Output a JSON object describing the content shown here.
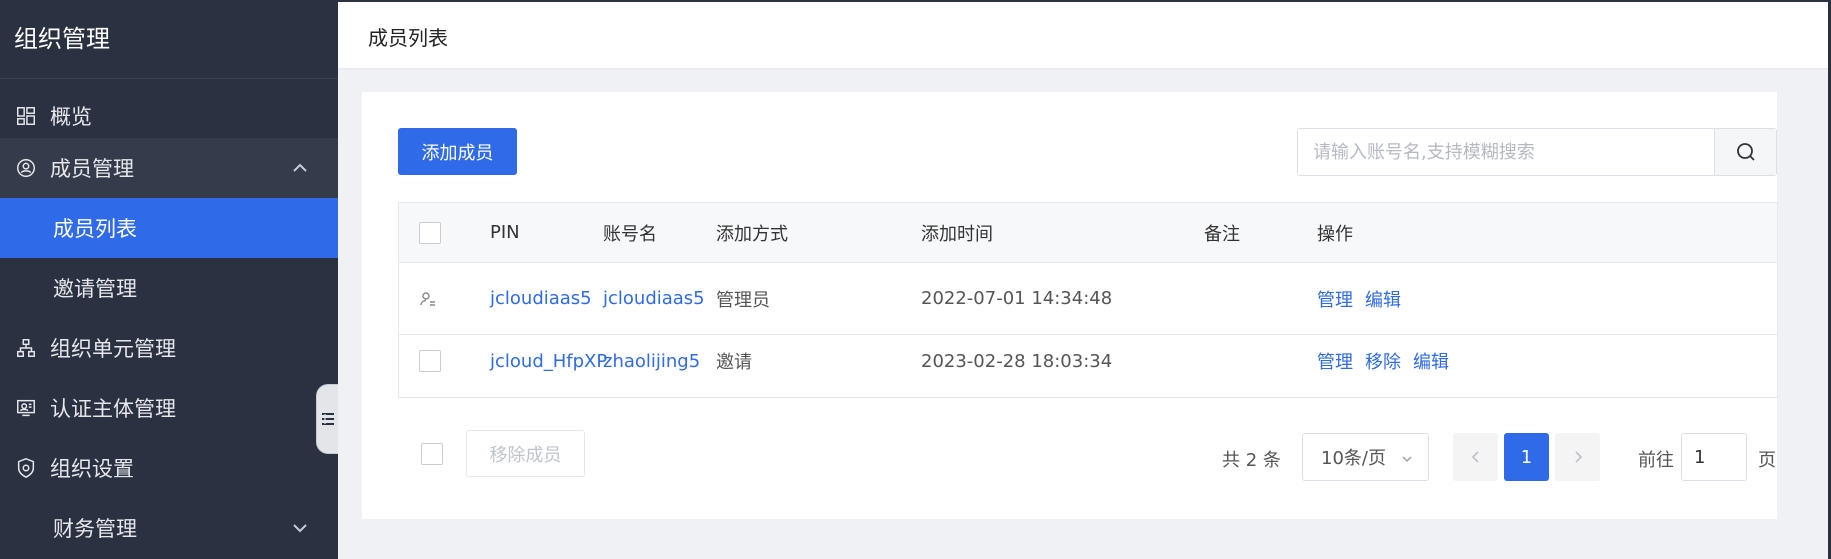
{
  "sidebar": {
    "title": "组织管理",
    "items": [
      {
        "label": "概览",
        "icon": "dashboard-icon"
      },
      {
        "label": "成员管理",
        "icon": "member-icon"
      },
      {
        "label": "成员列表"
      },
      {
        "label": "邀请管理"
      },
      {
        "label": "组织单元管理",
        "icon": "org-unit-icon"
      },
      {
        "label": "认证主体管理",
        "icon": "certification-icon"
      },
      {
        "label": "组织设置",
        "icon": "settings-shield-icon"
      },
      {
        "label": "财务管理"
      }
    ]
  },
  "header": {
    "title": "成员列表"
  },
  "toolbar": {
    "add_label": "添加成员",
    "search_placeholder": "请输入账号名,支持模糊搜索"
  },
  "table": {
    "columns": [
      "PIN",
      "账号名",
      "添加方式",
      "添加时间",
      "备注",
      "操作"
    ],
    "rows": [
      {
        "pin": "jcloudiaas5",
        "account": "jcloudiaas5",
        "method": "管理员",
        "time": "2022-07-01 14:34:48",
        "note": "",
        "actions": [
          "管理",
          "编辑"
        ]
      },
      {
        "pin": "jcloud_HfpXP",
        "account": "zhaolijing5",
        "method": "邀请",
        "time": "2023-02-28 18:03:34",
        "note": "",
        "actions": [
          "管理",
          "移除",
          "编辑"
        ]
      }
    ]
  },
  "footer": {
    "remove_label": "移除成员",
    "total": "共 2 条",
    "page_size": "10条/页",
    "current_page": "1",
    "goto_prefix": "前往",
    "goto_value": "1",
    "goto_suffix": "页"
  },
  "colors": {
    "primary": "#2f6ae8",
    "sidebar": "#2a3140"
  }
}
